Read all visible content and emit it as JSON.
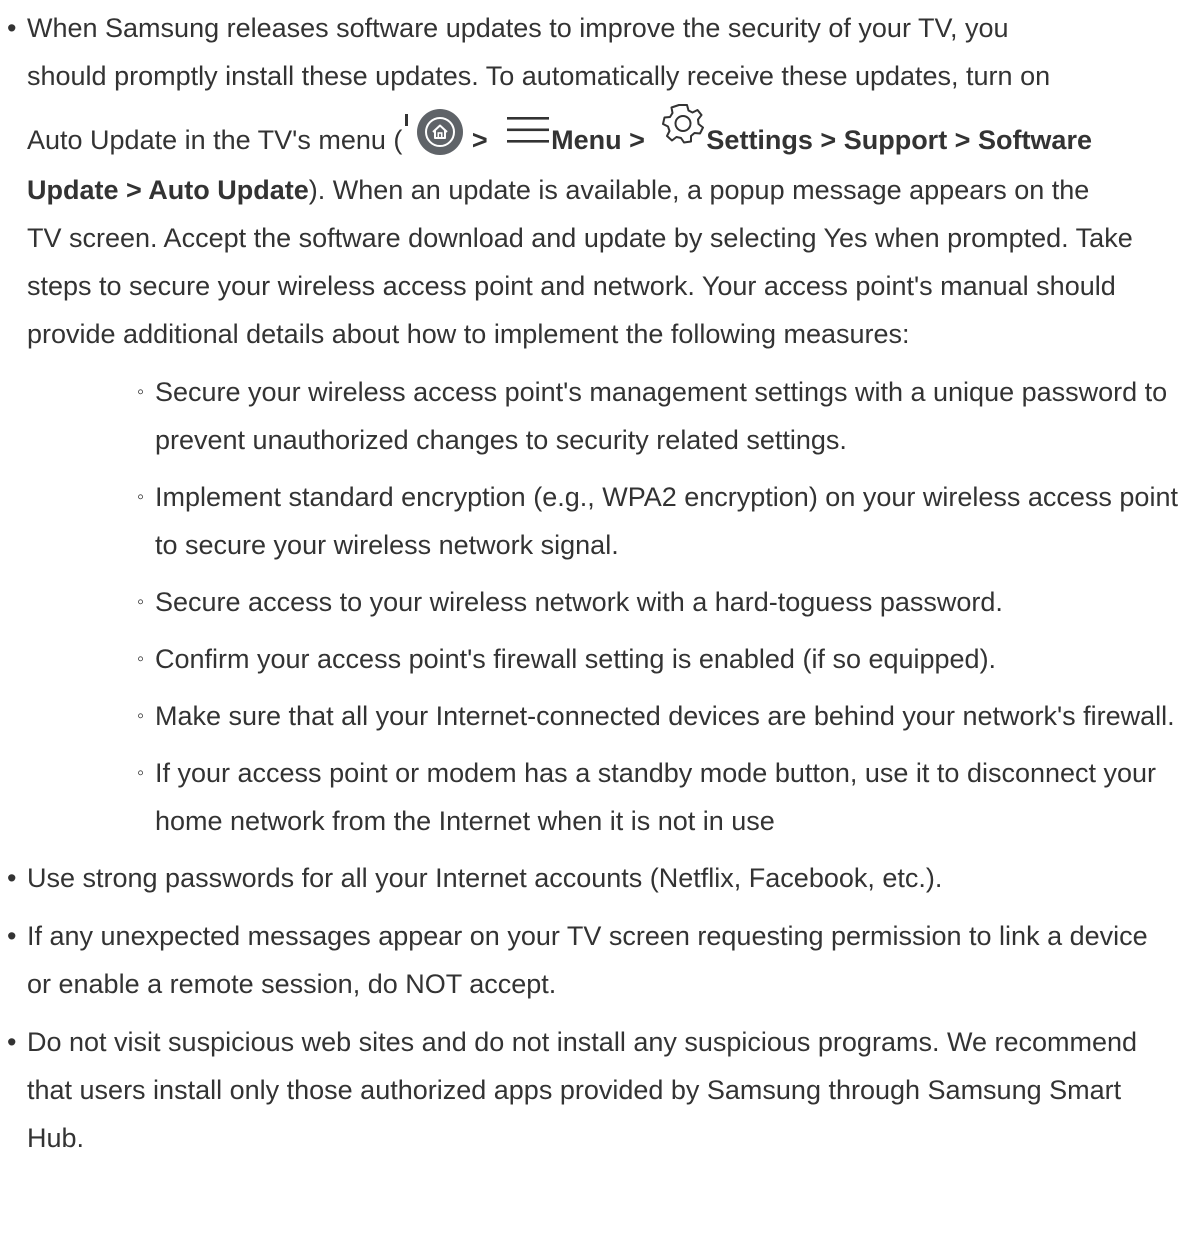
{
  "items": [
    {
      "line1": "When Samsung releases software updates to improve the security of your TV, you",
      "line2": "should promptly install these updates. To automatically receive these updates, turn on",
      "auto_pre": "Auto Update in the TV's menu (",
      "sep1": " > ",
      "menu_label": "Menu > ",
      "settings_path": "Settings > Support > Software",
      "path_cont": "Update > Auto Update",
      "after_path": "). When an update is available, a popup message appears on the",
      "rest": "TV screen. Accept the software download and update by selecting Yes when prompted. Take steps to secure your wireless access point and network. Your access point's manual should provide additional details about how to implement the following measures:",
      "icons": [
        "home-icon",
        "menu-icon",
        "gear-icon"
      ],
      "subitems": [
        "Secure your wireless access point's management settings with a unique password to prevent unauthorized changes to security related settings.",
        "Implement standard encryption (e.g., WPA2 encryption) on your wireless access point to secure your wireless network signal.",
        "Secure access to your wireless network with a hard-toguess password.",
        "Confirm your access point's firewall setting is enabled (if so equipped).",
        "Make sure that all your Internet-connected devices are behind your network's firewall.",
        "If your access point or modem has a standby mode button, use it to disconnect your home network from the Internet when it is not in use"
      ]
    },
    {
      "text": "Use strong passwords for all your Internet accounts (Netflix, Facebook, etc.)."
    },
    {
      "text": "If any unexpected messages appear on your TV screen requesting permission to link a device or enable a remote session, do NOT accept."
    },
    {
      "text": "Do not visit suspicious web sites and do not install any suspicious programs. We recommend that users install only those authorized apps provided by Samsung through Samsung Smart Hub."
    }
  ],
  "colors": {
    "text": "#333333",
    "home_icon_bg": "#5f6368"
  }
}
